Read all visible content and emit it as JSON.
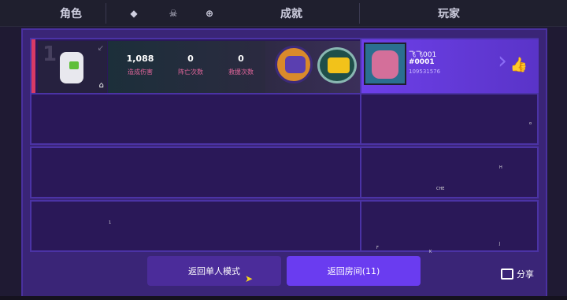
{
  "header": {
    "tabs": [
      {
        "label": "角色"
      },
      {
        "icon": "tag-icon"
      },
      {
        "icon": "skull-icon"
      },
      {
        "icon": "plus-circle-icon"
      },
      {
        "label": "成就"
      },
      {
        "label": "玩家"
      }
    ]
  },
  "rows": {
    "first": {
      "rank": "1",
      "stats": [
        {
          "value": "1,088",
          "label": "造成伤害"
        },
        {
          "value": "0",
          "label": "阵亡次数"
        },
        {
          "value": "0",
          "label": "救援次数"
        }
      ],
      "player": {
        "name": "飞飞001",
        "id": "#0001",
        "number": "109531576"
      }
    },
    "empty_rows": [
      {
        "dots": [
          "o"
        ]
      },
      {
        "dots": [
          "H",
          "CHE"
        ]
      },
      {
        "dots": [
          "1",
          "F",
          "K",
          "J"
        ]
      }
    ]
  },
  "buttons": {
    "back_single": "返回单人模式",
    "back_room": "返回房间(11)",
    "share": "分享"
  },
  "colors": {
    "panel": "#3a2577",
    "row": "#2a1858",
    "accent": "#6a3cf0",
    "red": "#d93a65"
  }
}
